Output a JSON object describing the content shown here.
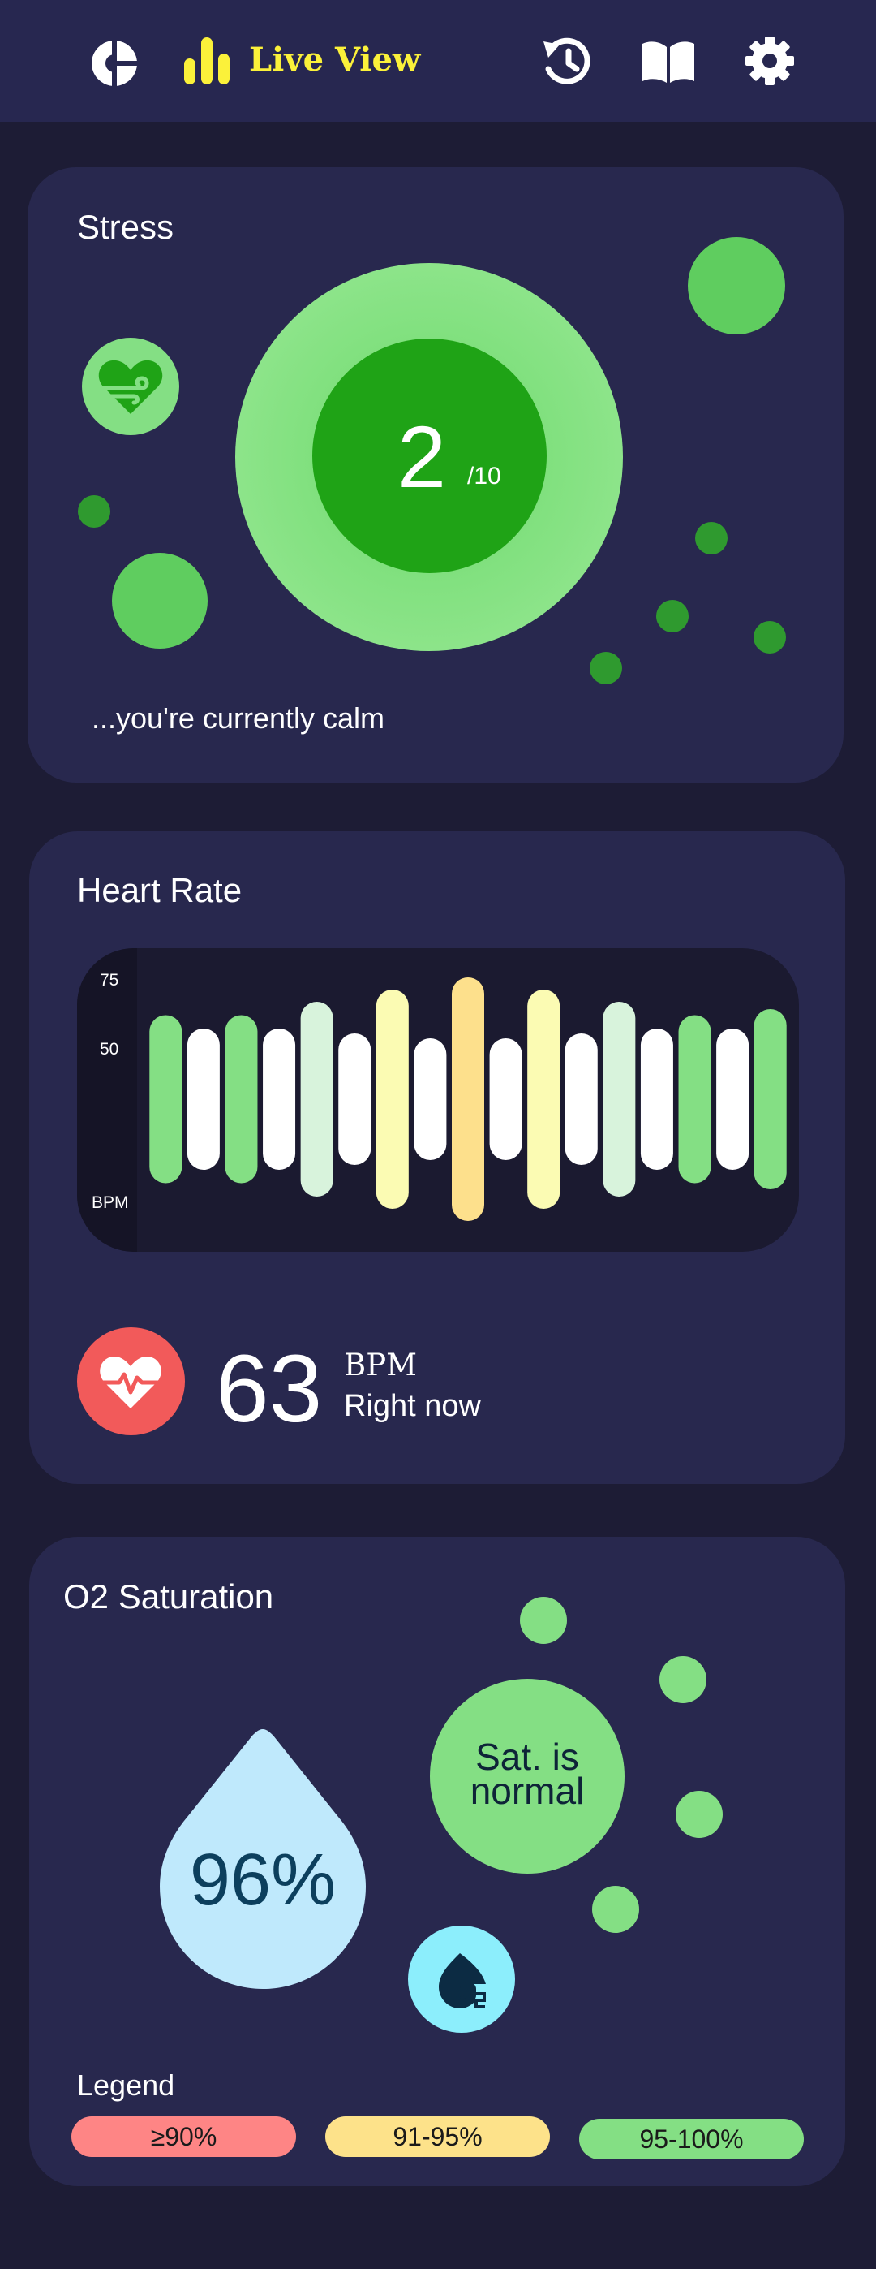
{
  "header": {
    "title": "Live View",
    "icons": [
      "pie-chart-icon",
      "bar-chart-icon",
      "history-icon",
      "book-icon",
      "gear-icon"
    ],
    "accent_color": "#fbf13a"
  },
  "stress": {
    "title": "Stress",
    "value": "2",
    "max_label": "/10",
    "message": "...you're currently calm",
    "level": 2,
    "level_max": 10
  },
  "heart_rate": {
    "title": "Heart Rate",
    "axis_ticks": [
      "75",
      "50"
    ],
    "axis_unit": "BPM",
    "value": "63",
    "unit": "BPM",
    "subtitle": "Right now"
  },
  "chart_data": {
    "type": "bar",
    "title": "",
    "ylabel": "BPM",
    "y_ticks": [
      75,
      50
    ],
    "series": [
      {
        "colors": [
          "#84df84",
          "#ffffff",
          "#84df84",
          "#ffffff",
          "#d8f3dc",
          "#ffffff",
          "#fbfbb3",
          "#ffffff",
          "#fde08c",
          "#ffffff",
          "#fbfbb3",
          "#ffffff",
          "#d8f3dc",
          "#ffffff",
          "#84df84",
          "#ffffff",
          "#84df84"
        ],
        "values": [
          69,
          58,
          69,
          58,
          80,
          54,
          90,
          50,
          100,
          50,
          90,
          54,
          80,
          58,
          69,
          58,
          74
        ]
      }
    ]
  },
  "o2": {
    "title": "O2 Saturation",
    "value": "96%",
    "status": [
      "Sat. is",
      "normal"
    ],
    "legend_title": "Legend",
    "legend": [
      {
        "label": "≥90%",
        "color": "#fe8585"
      },
      {
        "label": "91-95%",
        "color": "#fde28a"
      },
      {
        "label": "95-100%",
        "color": "#84df84"
      }
    ]
  }
}
